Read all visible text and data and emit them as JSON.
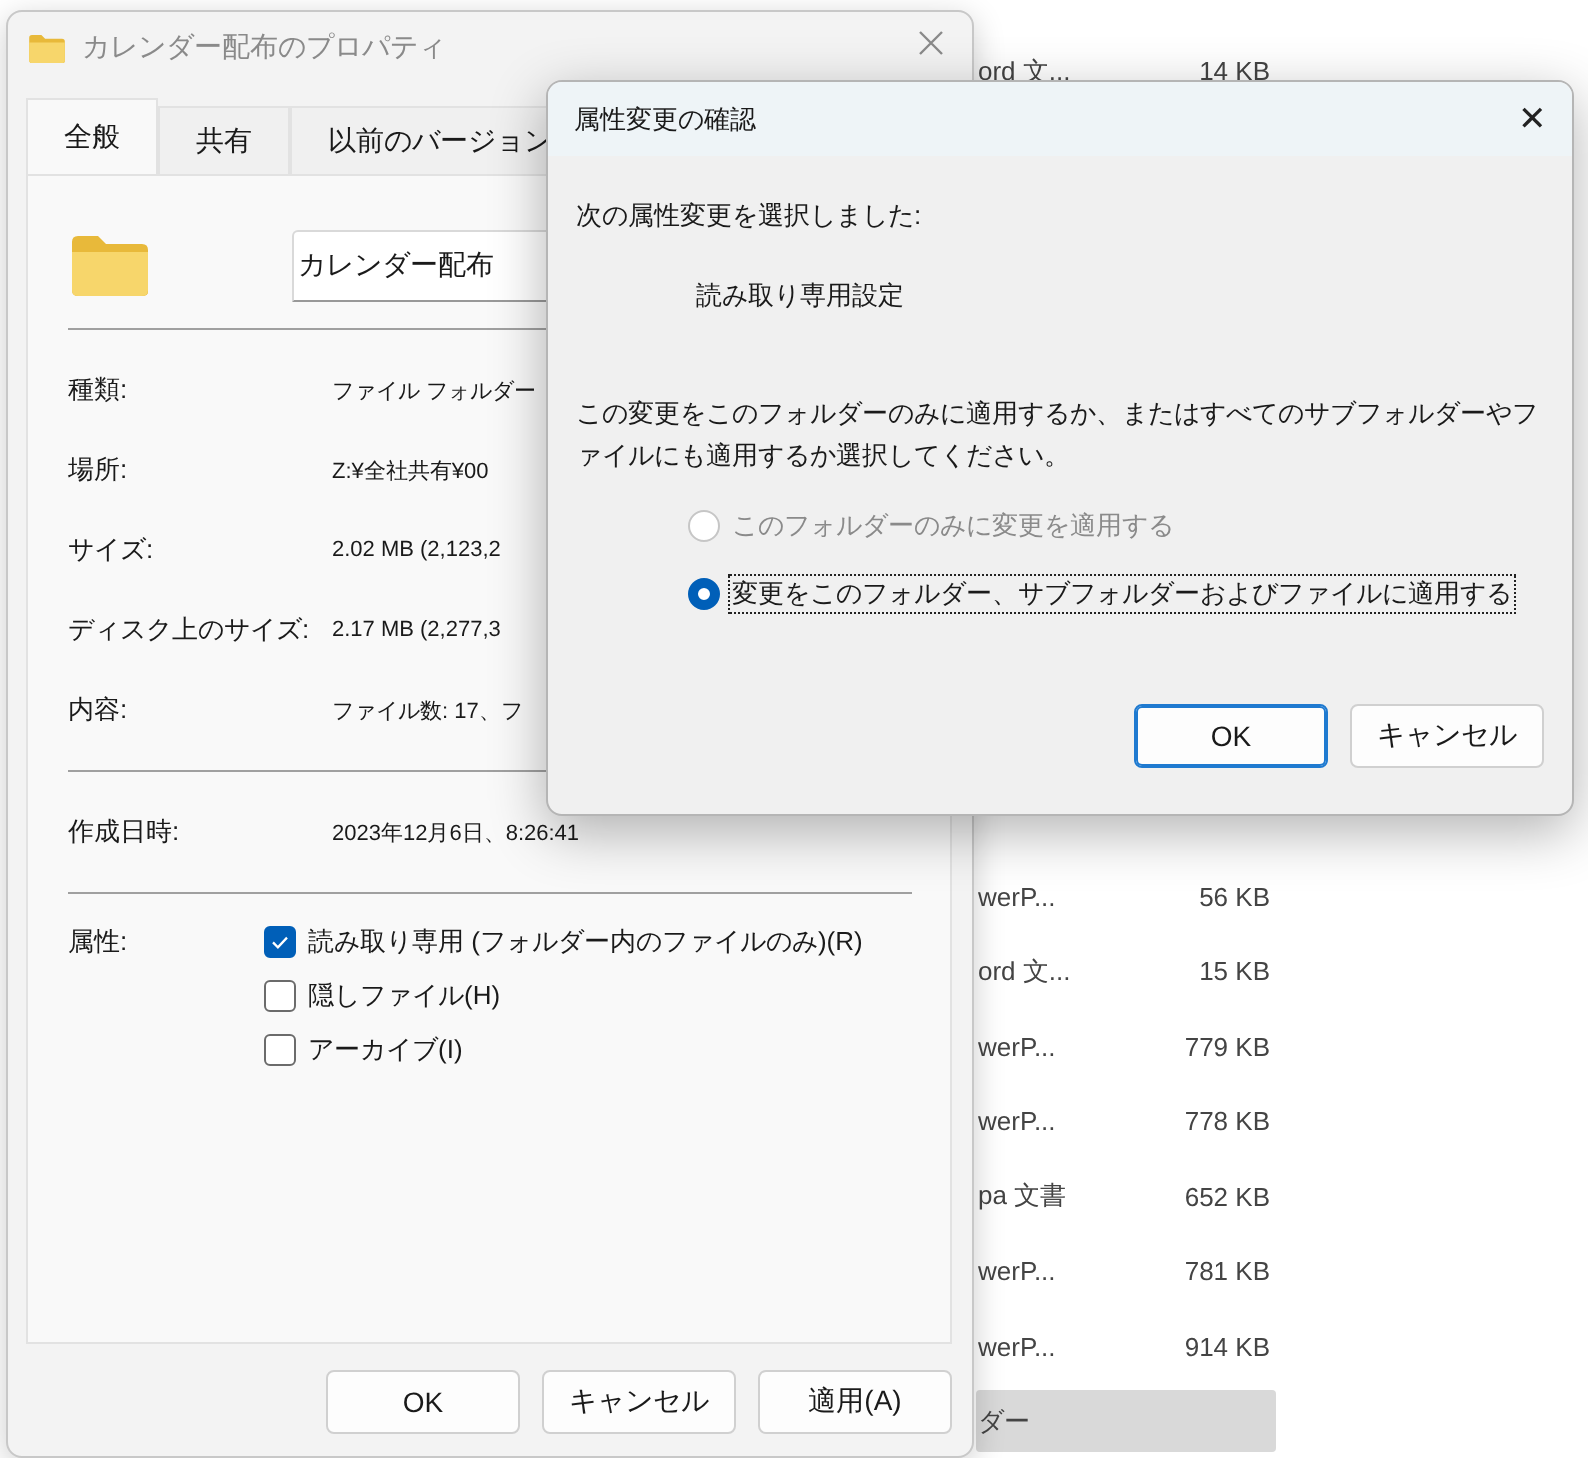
{
  "file_list": {
    "upper_rows": [
      {
        "type": "ord 文...",
        "size": "14 KB",
        "selected": false
      }
    ],
    "lower_rows": [
      {
        "type": "werP...",
        "size": "56 KB",
        "selected": false
      },
      {
        "type": "ord 文...",
        "size": "15 KB",
        "selected": false
      },
      {
        "type": "werP...",
        "size": "779 KB",
        "selected": false
      },
      {
        "type": "werP...",
        "size": "778 KB",
        "selected": false
      },
      {
        "type": "pa 文書",
        "size": "652 KB",
        "selected": false
      },
      {
        "type": "werP...",
        "size": "781 KB",
        "selected": false
      },
      {
        "type": "werP...",
        "size": "914 KB",
        "selected": false
      },
      {
        "type": "ダー",
        "size": "",
        "selected": true
      }
    ]
  },
  "properties_window": {
    "title": "カレンダー配布のプロパティ",
    "tabs": [
      {
        "label": "全般",
        "selected": true
      },
      {
        "label": "共有",
        "selected": false
      },
      {
        "label": "以前のバージョン",
        "selected": false
      }
    ],
    "name_field": {
      "value": "カレンダー配布"
    },
    "info_rows": [
      {
        "label": "種類:",
        "value": "ファイル フォルダー"
      },
      {
        "label": "場所:",
        "value": "Z:¥全社共有¥00"
      },
      {
        "label": "サイズ:",
        "value": "2.02 MB (2,123,2"
      },
      {
        "label": "ディスク上のサイズ:",
        "value": "2.17 MB (2,277,3"
      },
      {
        "label": "内容:",
        "value": "ファイル数: 17、フ"
      }
    ],
    "created": {
      "label": "作成日時:",
      "value": "2023年12月6日、8:26:41"
    },
    "attributes": {
      "label": "属性:",
      "items": [
        {
          "label": "読み取り専用 (フォルダー内のファイルのみ)(R)",
          "checked": true
        },
        {
          "label": "隠しファイル(H)",
          "checked": false
        },
        {
          "label": "アーカイブ(I)",
          "checked": false
        }
      ]
    },
    "buttons": [
      {
        "label": "OK"
      },
      {
        "label": "キャンセル"
      },
      {
        "label": "適用(A)"
      }
    ]
  },
  "confirm_dialog": {
    "title": "属性変更の確認",
    "close": "✕",
    "intro": "次の属性変更を選択しました:",
    "change": "読み取り専用設定",
    "question": "この変更をこのフォルダーのみに適用するか、またはすべてのサブフォルダーやファイルにも適用するか選択してください。",
    "options": [
      {
        "label": "このフォルダーのみに変更を適用する",
        "selected": false,
        "disabled": true,
        "focused": false
      },
      {
        "label": "変更をこのフォルダー、サブフォルダーおよびファイルに適用する",
        "selected": true,
        "disabled": false,
        "focused": true
      }
    ],
    "buttons": [
      {
        "label": "OK",
        "default": true
      },
      {
        "label": "キャンセル",
        "default": false
      }
    ]
  }
}
